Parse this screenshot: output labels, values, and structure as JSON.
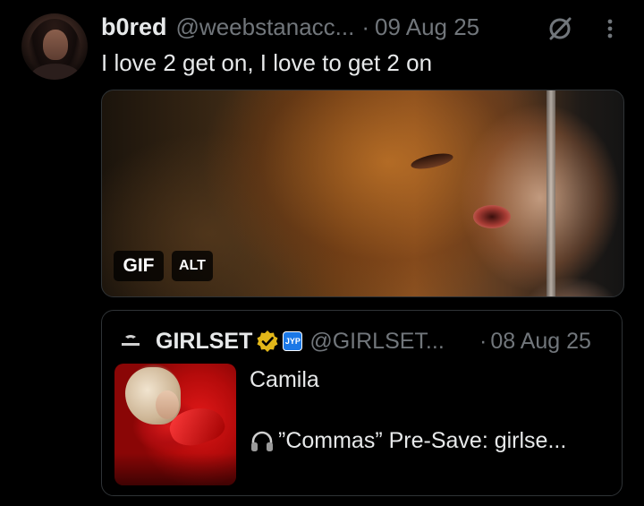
{
  "post": {
    "display_name": "b0red",
    "handle": "@weebstanacc...",
    "separator": "·",
    "date": "09 Aug 25",
    "text": "I love 2 get on, I love to get 2 on",
    "media": {
      "type_badge": "GIF",
      "alt_badge": "ALT"
    },
    "icons": {
      "avatar": "avatar",
      "grok": "grok-icon",
      "more": "more-options-icon"
    }
  },
  "quoted_post": {
    "display_name": "GIRLSET",
    "handle": "@GIRLSET...",
    "separator": "·",
    "date": "08 Aug 25",
    "title": "Camila",
    "body": "”Commas” Pre-Save: girlse...",
    "icons": {
      "logo": "girlset-logo-icon",
      "verified": "verified-gold-icon",
      "affiliate": "affiliate-badge-icon",
      "headphones": "headphones-icon"
    },
    "affiliate_text": "JYP"
  },
  "colors": {
    "background": "#000000",
    "primary_text": "#e7e9ea",
    "secondary_text": "#71767b",
    "border": "#2f3336",
    "verified_gold": "#e2b719"
  }
}
